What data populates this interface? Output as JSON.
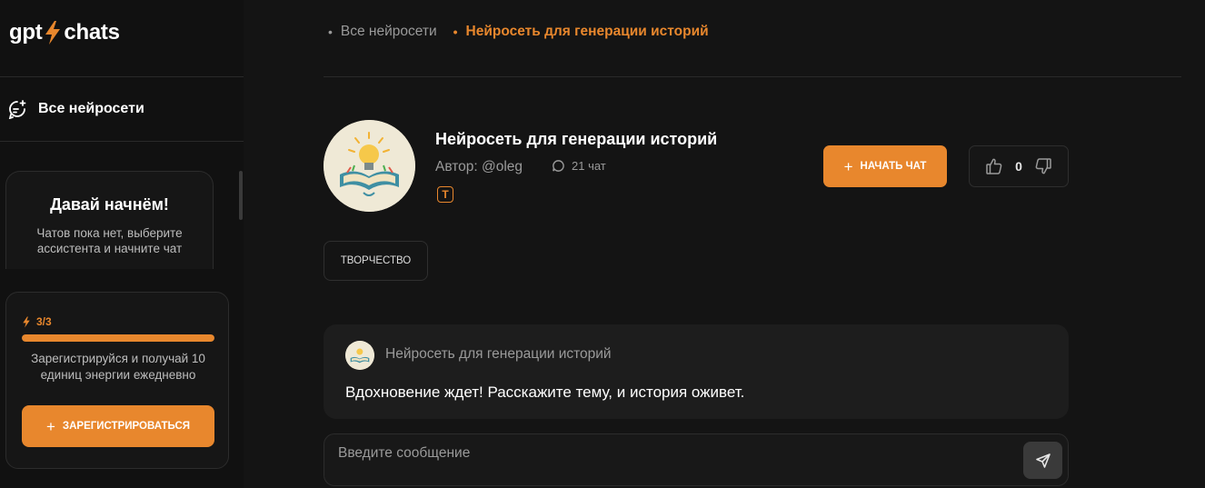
{
  "brand": {
    "logo_left": "gpt",
    "logo_right": "chats",
    "accent_color": "#e8872d"
  },
  "sidebar": {
    "nav_all_label": "Все нейросети",
    "welcome": {
      "title": "Давай начнём!",
      "text": "Чатов пока нет, выберите ассистента и начните чат"
    },
    "energy": {
      "counter": "3/3",
      "fill_fraction": 1.0,
      "text": "Зарегистрируйся и получай 10 единиц энергии ежедневно",
      "register_label": "ЗАРЕГИСТРИРОВАТЬСЯ"
    }
  },
  "breadcrumb": [
    {
      "label": "Все нейросети"
    },
    {
      "label": "Нейросеть для генерации историй"
    }
  ],
  "bot": {
    "title": "Нейросеть для генерации историй",
    "author": "Автор: @oleg",
    "chats": "21 чат",
    "badge": "T",
    "start_label": "НАЧАТЬ ЧАТ",
    "likes": "0"
  },
  "tags": [
    "ТВОРЧЕСТВО"
  ],
  "message": {
    "author": "Нейросеть для генерации историй",
    "text": "Вдохновение ждет! Расскажите тему, и история оживет."
  },
  "composer": {
    "placeholder": "Введите сообщение"
  },
  "icons": {
    "nav_all": "sparkle-chat-icon",
    "bolt": "lightning-bolt-icon",
    "chats": "speech-bubble-icon",
    "like": "thumbs-up-icon",
    "dislike": "thumbs-down-icon",
    "send": "paper-plane-icon",
    "plus": "plus-icon"
  }
}
